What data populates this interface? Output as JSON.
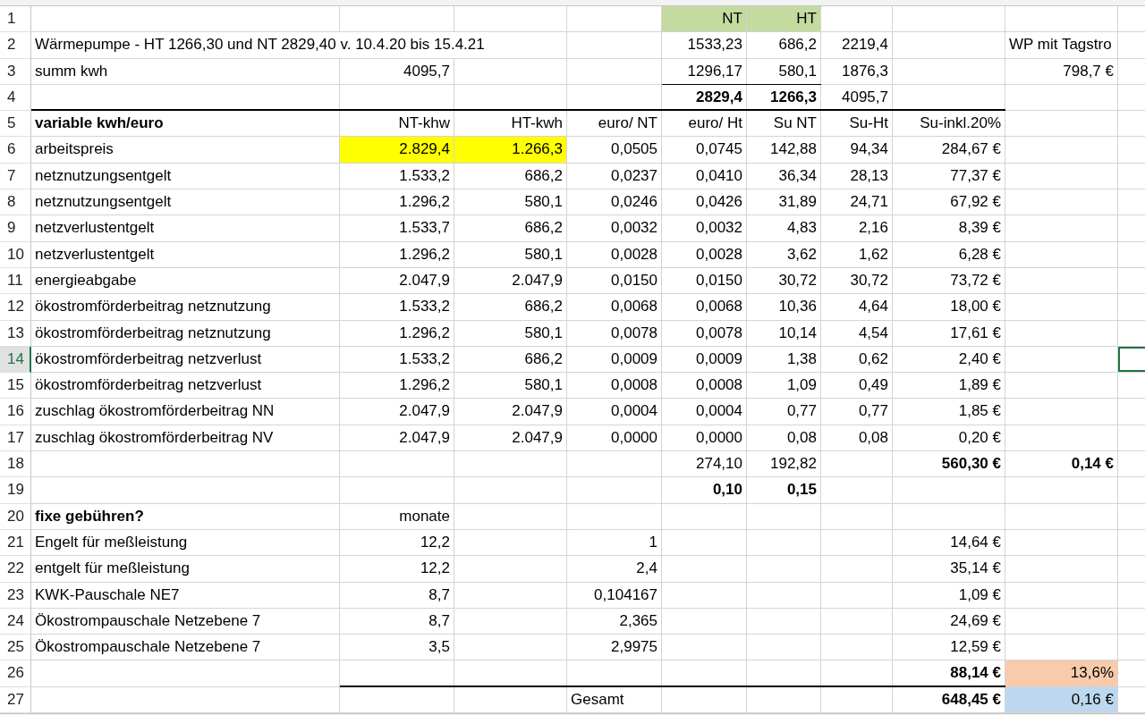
{
  "rows": [
    {
      "number": "1",
      "selected": false,
      "cells": [
        null,
        null,
        null,
        null,
        {
          "text": "NT",
          "kind": "heading",
          "bold": false,
          "color": "#c4dba0"
        },
        {
          "text": "HT",
          "kind": "heading",
          "bold": false,
          "color": "#c4dba0"
        }
      ]
    },
    {
      "number": "2",
      "selected": false,
      "cells": [
        {
          "text": "Wärmepumpe - HT 1266,30 und NT 2829,40 v. 10.4.20 bis 15.4.21",
          "kind": "label",
          "bold": false
        },
        null,
        null,
        null,
        {
          "text": "1533,23",
          "kind": "number",
          "bold": false
        },
        {
          "text": "686,2",
          "kind": "number",
          "bold": false
        },
        {
          "text": "2219,4",
          "kind": "number",
          "bold": false
        },
        null,
        {
          "text": "WP mit Tagstro",
          "kind": "label",
          "bold": false
        }
      ]
    },
    {
      "number": "3",
      "selected": false,
      "cells": [
        {
          "text": "summ kwh",
          "kind": "label",
          "bold": false
        },
        {
          "text": "4095,7",
          "kind": "number",
          "bold": false
        },
        null,
        null,
        {
          "text": "1296,17",
          "kind": "number",
          "bold": false
        },
        {
          "text": "580,1",
          "kind": "number",
          "bold": false
        },
        {
          "text": "1876,3",
          "kind": "number",
          "bold": false
        },
        null,
        {
          "text": "798,7 €",
          "kind": "number",
          "bold": false
        }
      ]
    },
    {
      "number": "4",
      "selected": false,
      "cells": [
        null,
        null,
        null,
        null,
        {
          "text": "2829,4",
          "kind": "number",
          "bold": true
        },
        {
          "text": "1266,3",
          "kind": "number",
          "bold": true
        },
        {
          "text": "4095,7",
          "kind": "number",
          "bold": false
        }
      ]
    },
    {
      "number": "5",
      "selected": false,
      "cells": [
        {
          "text": "variable kwh/euro",
          "kind": "label",
          "bold": true
        },
        {
          "text": "NT-khw",
          "kind": "heading",
          "bold": false
        },
        {
          "text": "HT-kwh",
          "kind": "heading",
          "bold": false
        },
        {
          "text": "euro/ NT",
          "kind": "heading",
          "bold": false
        },
        {
          "text": "euro/ Ht",
          "kind": "heading",
          "bold": false
        },
        {
          "text": "Su NT",
          "kind": "heading",
          "bold": false
        },
        {
          "text": "Su-Ht",
          "kind": "heading",
          "bold": false
        },
        {
          "text": "Su-inkl.20%",
          "kind": "heading",
          "bold": false
        }
      ]
    },
    {
      "number": "6",
      "selected": false,
      "cells": [
        {
          "text": "arbeitspreis",
          "kind": "label",
          "bold": false
        },
        {
          "text": "2.829,4",
          "kind": "number",
          "bold": false,
          "color": "#ffff00"
        },
        {
          "text": "1.266,3",
          "kind": "number",
          "bold": false,
          "color": "#ffff00"
        },
        {
          "text": "0,0505",
          "kind": "number",
          "bold": false
        },
        {
          "text": "0,0745",
          "kind": "number",
          "bold": false
        },
        {
          "text": "142,88",
          "kind": "number",
          "bold": false
        },
        {
          "text": "94,34",
          "kind": "number",
          "bold": false
        },
        {
          "text": "284,67 €",
          "kind": "number",
          "bold": false
        }
      ]
    },
    {
      "number": "7",
      "selected": false,
      "cells": [
        {
          "text": "netznutzungsentgelt",
          "kind": "label",
          "bold": false
        },
        {
          "text": "1.533,2",
          "kind": "number",
          "bold": false
        },
        {
          "text": "686,2",
          "kind": "number",
          "bold": false
        },
        {
          "text": "0,0237",
          "kind": "number",
          "bold": false
        },
        {
          "text": "0,0410",
          "kind": "number",
          "bold": false
        },
        {
          "text": "36,34",
          "kind": "number",
          "bold": false
        },
        {
          "text": "28,13",
          "kind": "number",
          "bold": false
        },
        {
          "text": "77,37 €",
          "kind": "number",
          "bold": false
        }
      ]
    },
    {
      "number": "8",
      "selected": false,
      "cells": [
        {
          "text": "netznutzungsentgelt",
          "kind": "label",
          "bold": false
        },
        {
          "text": "1.296,2",
          "kind": "number",
          "bold": false
        },
        {
          "text": "580,1",
          "kind": "number",
          "bold": false
        },
        {
          "text": "0,0246",
          "kind": "number",
          "bold": false
        },
        {
          "text": "0,0426",
          "kind": "number",
          "bold": false
        },
        {
          "text": "31,89",
          "kind": "number",
          "bold": false
        },
        {
          "text": "24,71",
          "kind": "number",
          "bold": false
        },
        {
          "text": "67,92 €",
          "kind": "number",
          "bold": false
        }
      ]
    },
    {
      "number": "9",
      "selected": false,
      "cells": [
        {
          "text": "netzverlustentgelt",
          "kind": "label",
          "bold": false
        },
        {
          "text": "1.533,7",
          "kind": "number",
          "bold": false
        },
        {
          "text": "686,2",
          "kind": "number",
          "bold": false
        },
        {
          "text": "0,0032",
          "kind": "number",
          "bold": false
        },
        {
          "text": "0,0032",
          "kind": "number",
          "bold": false
        },
        {
          "text": "4,83",
          "kind": "number",
          "bold": false
        },
        {
          "text": "2,16",
          "kind": "number",
          "bold": false
        },
        {
          "text": "8,39 €",
          "kind": "number",
          "bold": false
        }
      ]
    },
    {
      "number": "10",
      "selected": false,
      "cells": [
        {
          "text": "netzverlustentgelt",
          "kind": "label",
          "bold": false
        },
        {
          "text": "1.296,2",
          "kind": "number",
          "bold": false
        },
        {
          "text": "580,1",
          "kind": "number",
          "bold": false
        },
        {
          "text": "0,0028",
          "kind": "number",
          "bold": false
        },
        {
          "text": "0,0028",
          "kind": "number",
          "bold": false
        },
        {
          "text": "3,62",
          "kind": "number",
          "bold": false
        },
        {
          "text": "1,62",
          "kind": "number",
          "bold": false
        },
        {
          "text": "6,28 €",
          "kind": "number",
          "bold": false
        }
      ]
    },
    {
      "number": "11",
      "selected": false,
      "cells": [
        {
          "text": "energieabgabe",
          "kind": "label",
          "bold": false
        },
        {
          "text": "2.047,9",
          "kind": "number",
          "bold": false
        },
        {
          "text": "2.047,9",
          "kind": "number",
          "bold": false
        },
        {
          "text": "0,0150",
          "kind": "number",
          "bold": false
        },
        {
          "text": "0,0150",
          "kind": "number",
          "bold": false
        },
        {
          "text": "30,72",
          "kind": "number",
          "bold": false
        },
        {
          "text": "30,72",
          "kind": "number",
          "bold": false
        },
        {
          "text": "73,72 €",
          "kind": "number",
          "bold": false
        }
      ]
    },
    {
      "number": "12",
      "selected": false,
      "cells": [
        {
          "text": "ökostromförderbeitrag netznutzung",
          "kind": "label",
          "bold": false
        },
        {
          "text": "1.533,2",
          "kind": "number",
          "bold": false
        },
        {
          "text": "686,2",
          "kind": "number",
          "bold": false
        },
        {
          "text": "0,0068",
          "kind": "number",
          "bold": false
        },
        {
          "text": "0,0068",
          "kind": "number",
          "bold": false
        },
        {
          "text": "10,36",
          "kind": "number",
          "bold": false
        },
        {
          "text": "4,64",
          "kind": "number",
          "bold": false
        },
        {
          "text": "18,00 €",
          "kind": "number",
          "bold": false
        }
      ]
    },
    {
      "number": "13",
      "selected": false,
      "cells": [
        {
          "text": "ökostromförderbeitrag netznutzung",
          "kind": "label",
          "bold": false
        },
        {
          "text": "1.296,2",
          "kind": "number",
          "bold": false
        },
        {
          "text": "580,1",
          "kind": "number",
          "bold": false
        },
        {
          "text": "0,0078",
          "kind": "number",
          "bold": false
        },
        {
          "text": "0,0078",
          "kind": "number",
          "bold": false
        },
        {
          "text": "10,14",
          "kind": "number",
          "bold": false
        },
        {
          "text": "4,54",
          "kind": "number",
          "bold": false
        },
        {
          "text": "17,61 €",
          "kind": "number",
          "bold": false
        }
      ]
    },
    {
      "number": "14",
      "selected": true,
      "cells": [
        {
          "text": "ökostromförderbeitrag netzverlust",
          "kind": "label",
          "bold": false
        },
        {
          "text": "1.533,2",
          "kind": "number",
          "bold": false
        },
        {
          "text": "686,2",
          "kind": "number",
          "bold": false
        },
        {
          "text": "0,0009",
          "kind": "number",
          "bold": false
        },
        {
          "text": "0,0009",
          "kind": "number",
          "bold": false
        },
        {
          "text": "1,38",
          "kind": "number",
          "bold": false
        },
        {
          "text": "0,62",
          "kind": "number",
          "bold": false
        },
        {
          "text": "2,40 €",
          "kind": "number",
          "bold": false
        },
        null,
        {
          "kind": "empty",
          "selected": true
        }
      ]
    },
    {
      "number": "15",
      "selected": false,
      "cells": [
        {
          "text": "ökostromförderbeitrag netzverlust",
          "kind": "label",
          "bold": false
        },
        {
          "text": "1.296,2",
          "kind": "number",
          "bold": false
        },
        {
          "text": "580,1",
          "kind": "number",
          "bold": false
        },
        {
          "text": "0,0008",
          "kind": "number",
          "bold": false
        },
        {
          "text": "0,0008",
          "kind": "number",
          "bold": false
        },
        {
          "text": "1,09",
          "kind": "number",
          "bold": false
        },
        {
          "text": "0,49",
          "kind": "number",
          "bold": false
        },
        {
          "text": "1,89 €",
          "kind": "number",
          "bold": false
        }
      ]
    },
    {
      "number": "16",
      "selected": false,
      "cells": [
        {
          "text": "zuschlag ökostromförderbeitrag NN",
          "kind": "label",
          "bold": false
        },
        {
          "text": "2.047,9",
          "kind": "number",
          "bold": false
        },
        {
          "text": "2.047,9",
          "kind": "number",
          "bold": false
        },
        {
          "text": "0,0004",
          "kind": "number",
          "bold": false
        },
        {
          "text": "0,0004",
          "kind": "number",
          "bold": false
        },
        {
          "text": "0,77",
          "kind": "number",
          "bold": false
        },
        {
          "text": "0,77",
          "kind": "number",
          "bold": false
        },
        {
          "text": "1,85 €",
          "kind": "number",
          "bold": false
        }
      ]
    },
    {
      "number": "17",
      "selected": false,
      "cells": [
        {
          "text": "zuschlag ökostromförderbeitrag NV",
          "kind": "label",
          "bold": false
        },
        {
          "text": "2.047,9",
          "kind": "number",
          "bold": false
        },
        {
          "text": "2.047,9",
          "kind": "number",
          "bold": false
        },
        {
          "text": "0,0000",
          "kind": "number",
          "bold": false
        },
        {
          "text": "0,0000",
          "kind": "number",
          "bold": false
        },
        {
          "text": "0,08",
          "kind": "number",
          "bold": false
        },
        {
          "text": "0,08",
          "kind": "number",
          "bold": false
        },
        {
          "text": "0,20 €",
          "kind": "number",
          "bold": false
        }
      ]
    },
    {
      "number": "18",
      "selected": false,
      "cells": [
        null,
        null,
        null,
        null,
        {
          "text": "274,10",
          "kind": "number",
          "bold": false
        },
        {
          "text": "192,82",
          "kind": "number",
          "bold": false
        },
        null,
        {
          "text": "560,30 €",
          "kind": "number",
          "bold": true
        },
        {
          "text": "0,14 €",
          "kind": "number",
          "bold": true
        }
      ]
    },
    {
      "number": "19",
      "selected": false,
      "cells": [
        null,
        null,
        null,
        null,
        {
          "text": "0,10",
          "kind": "number",
          "bold": true
        },
        {
          "text": "0,15",
          "kind": "number",
          "bold": true
        }
      ]
    },
    {
      "number": "20",
      "selected": false,
      "cells": [
        {
          "text": "fixe gebühren?",
          "kind": "label",
          "bold": true
        },
        {
          "text": "monate",
          "kind": "heading",
          "bold": false
        }
      ]
    },
    {
      "number": "21",
      "selected": false,
      "cells": [
        {
          "text": "Engelt für meßleistung",
          "kind": "label",
          "bold": false
        },
        {
          "text": "12,2",
          "kind": "number",
          "bold": false
        },
        null,
        {
          "text": "1",
          "kind": "number",
          "bold": false
        },
        null,
        null,
        null,
        {
          "text": "14,64 €",
          "kind": "number",
          "bold": false
        }
      ]
    },
    {
      "number": "22",
      "selected": false,
      "cells": [
        {
          "text": "entgelt für meßleistung",
          "kind": "label",
          "bold": false
        },
        {
          "text": "12,2",
          "kind": "number",
          "bold": false
        },
        null,
        {
          "text": "2,4",
          "kind": "number",
          "bold": false
        },
        null,
        null,
        null,
        {
          "text": "35,14 €",
          "kind": "number",
          "bold": false
        }
      ]
    },
    {
      "number": "23",
      "selected": false,
      "cells": [
        {
          "text": "KWK-Pauschale NE7",
          "kind": "label",
          "bold": false
        },
        {
          "text": "8,7",
          "kind": "number",
          "bold": false
        },
        null,
        {
          "text": "0,104167",
          "kind": "number",
          "bold": false
        },
        null,
        null,
        null,
        {
          "text": "1,09 €",
          "kind": "number",
          "bold": false
        }
      ]
    },
    {
      "number": "24",
      "selected": false,
      "cells": [
        {
          "text": "Ökostrompauschale Netzebene 7",
          "kind": "label",
          "bold": false
        },
        {
          "text": "8,7",
          "kind": "number",
          "bold": false
        },
        null,
        {
          "text": "2,365",
          "kind": "number",
          "bold": false
        },
        null,
        null,
        null,
        {
          "text": "24,69 €",
          "kind": "number",
          "bold": false
        }
      ]
    },
    {
      "number": "25",
      "selected": false,
      "cells": [
        {
          "text": "Ökostrompauschale Netzebene 7",
          "kind": "label",
          "bold": false
        },
        {
          "text": "3,5",
          "kind": "number",
          "bold": false
        },
        null,
        {
          "text": "2,9975",
          "kind": "number",
          "bold": false
        },
        null,
        null,
        null,
        {
          "text": "12,59 €",
          "kind": "number",
          "bold": false
        }
      ]
    },
    {
      "number": "26",
      "selected": false,
      "cells": [
        null,
        null,
        null,
        null,
        null,
        null,
        null,
        {
          "text": "88,14 €",
          "kind": "number",
          "bold": true
        },
        {
          "text": "13,6%",
          "kind": "number",
          "bold": false,
          "color": "#f8cbad"
        }
      ]
    },
    {
      "number": "27",
      "selected": false,
      "cells": [
        null,
        null,
        null,
        {
          "text": "Gesamt",
          "kind": "label",
          "bold": false
        },
        null,
        null,
        null,
        {
          "text": "648,45 €",
          "kind": "number",
          "bold": true
        },
        {
          "text": "0,16 €",
          "kind": "number",
          "bold": false,
          "color": "#bdd7ee"
        }
      ]
    }
  ]
}
